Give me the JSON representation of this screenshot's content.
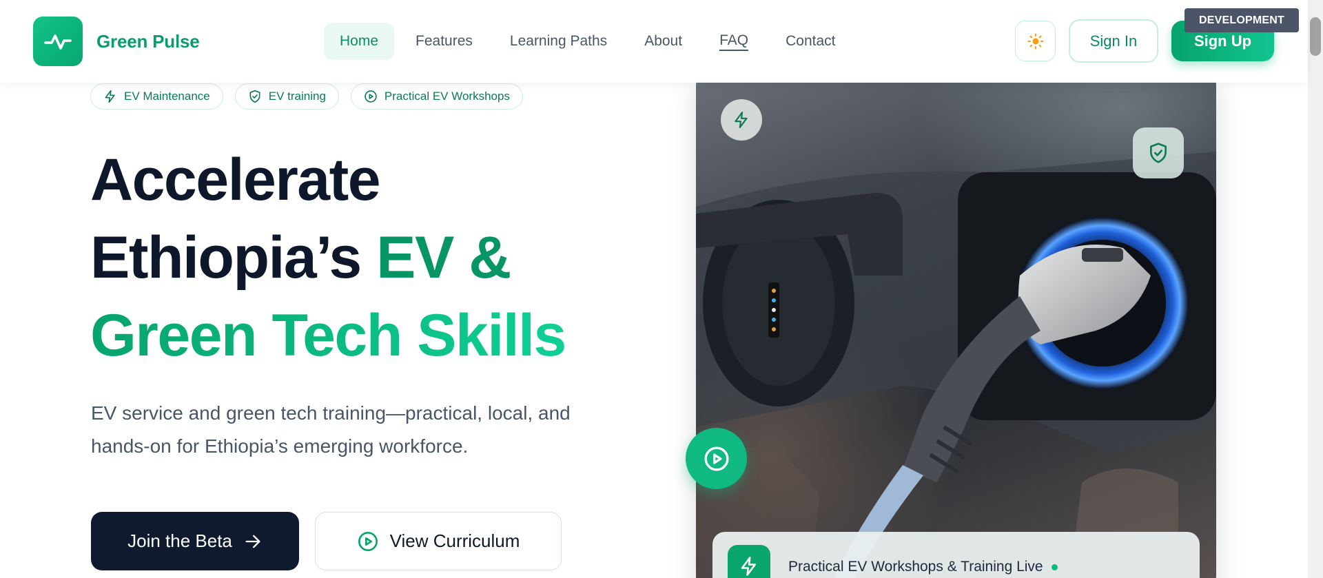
{
  "brand": {
    "name": "Green Pulse",
    "color": "#0a9c6a"
  },
  "nav": {
    "items": [
      "Home",
      "Features",
      "Learning Paths",
      "About",
      "FAQ",
      "Contact"
    ],
    "active": "Home"
  },
  "header": {
    "theme_icon": "sun-icon",
    "signin_label": "Sign In",
    "signup_label": "Sign Up",
    "env_badge": "DEVELOPMENT"
  },
  "hero": {
    "tags": [
      {
        "label": "EV Maintenance",
        "icon": "bolt-icon"
      },
      {
        "label": "EV training",
        "icon": "shield-icon"
      },
      {
        "label": "Practical EV Workshops",
        "icon": "play-circle-icon"
      }
    ],
    "headline": {
      "line1": "Accelerate",
      "line2_dark": "Ethiopia’s",
      "line2_green": "EV &",
      "line3": "Green Tech Skills"
    },
    "subtitle": "EV service and green tech training—practical, local, and hands-on for Ethiopia’s emerging workforce.",
    "primary_cta": "Join the Beta",
    "secondary_cta": "View Curriculum"
  },
  "image_card": {
    "description_icon_chips": [
      "bolt-icon",
      "shield-check-icon",
      "play-circle-icon"
    ],
    "live_banner": "Practical EV Workshops & Training Live"
  },
  "colors": {
    "accent": "#10b981",
    "accent_dark": "#079565",
    "navy": "#101a2f",
    "text_muted": "#475569"
  }
}
